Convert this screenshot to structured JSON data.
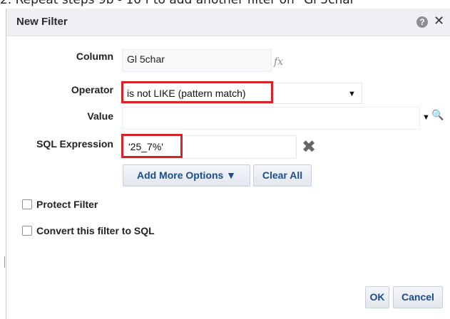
{
  "background_text": "2. Repeat steps 9b - 10 f to add another filter on \"Gl 5char\"",
  "dialog": {
    "title": "New Filter",
    "help_icon": "question-icon",
    "help_glyph": "?",
    "close_icon": "close-icon",
    "close_glyph": "✕"
  },
  "form": {
    "column_label": "Column",
    "column_value": "Gl 5char",
    "fx_label": "fx",
    "operator_label": "Operator",
    "operator_value": "is not LIKE (pattern match)",
    "value_label": "Value",
    "value_value": "",
    "sql_label": "SQL Expression",
    "sql_value": "'25_7%'",
    "dropdown_glyph": "▼",
    "search_glyph": "🔍",
    "clear_glyph": "✖"
  },
  "buttons": {
    "add_more_options": "Add More Options ▼",
    "clear_all": "Clear All",
    "ok": "OK",
    "cancel": "Cancel"
  },
  "options": {
    "protect_filter": "Protect Filter",
    "convert_to_sql": "Convert this filter to SQL"
  },
  "colors": {
    "highlight": "#d8222a",
    "button_text": "#1c4d8a",
    "title_bar": "#eef0f3"
  }
}
